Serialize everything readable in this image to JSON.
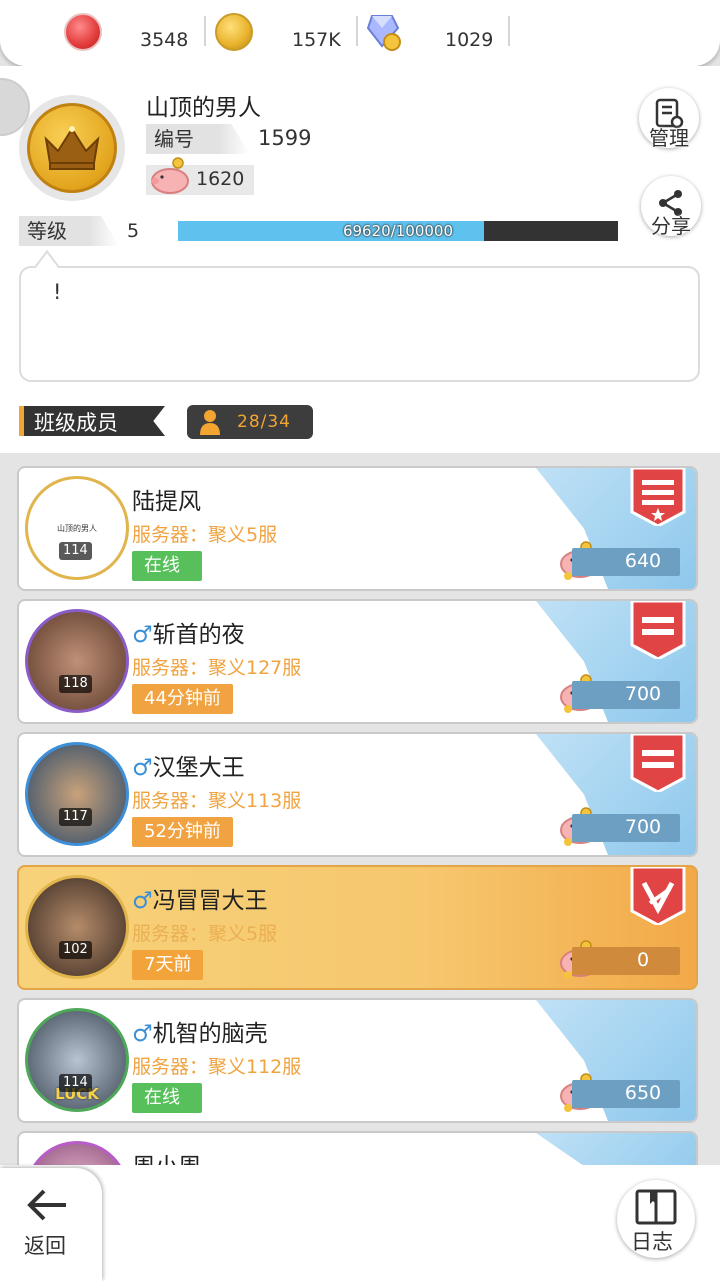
{
  "currency": {
    "ruby": "3548",
    "gold": "157K",
    "gem": "1029"
  },
  "profile": {
    "name": "山顶的男人",
    "id_label": "编号",
    "id_value": "1599",
    "coins": "1620",
    "level_label": "等级",
    "level_value": "5",
    "xp_text": "69620/100000",
    "xp_progress": 0.6962,
    "manage_label": "管理",
    "share_label": "分享",
    "notice_text": "!"
  },
  "members_section": {
    "title": "班级成员",
    "count": "28/34"
  },
  "members": [
    {
      "gender": "",
      "name": "陆提风",
      "server": "服务器：聚义5服",
      "status": "在线",
      "level": "114",
      "coins": "640",
      "avatar_text": "山顶的男人"
    },
    {
      "gender": "♂",
      "name": "斩首的夜",
      "server": "服务器：聚义127服",
      "status": "44分钟前",
      "level": "118",
      "coins": "700"
    },
    {
      "gender": "♂",
      "name": "汉堡大王",
      "server": "服务器：聚义113服",
      "status": "52分钟前",
      "level": "117",
      "coins": "700"
    },
    {
      "gender": "♂",
      "name": "冯冒冒大王",
      "server": "服务器：聚义5服",
      "status": "7天前",
      "level": "102",
      "coins": "0"
    },
    {
      "gender": "♂",
      "name": "机智的脑壳",
      "server": "服务器：聚义112服",
      "status": "在线",
      "level": "114",
      "coins": "650",
      "avatar_text": "LUCK"
    },
    {
      "gender": "",
      "name": "周小周",
      "server": "",
      "status": "",
      "level": "",
      "coins": ""
    }
  ],
  "bottom": {
    "back_label": "返回",
    "log_label": "日志"
  },
  "colors": {
    "accent_orange": "#f0a340",
    "online_green": "#57c05a",
    "xp_blue": "#5fc2ee",
    "gender_blue": "#3b8fd6"
  }
}
